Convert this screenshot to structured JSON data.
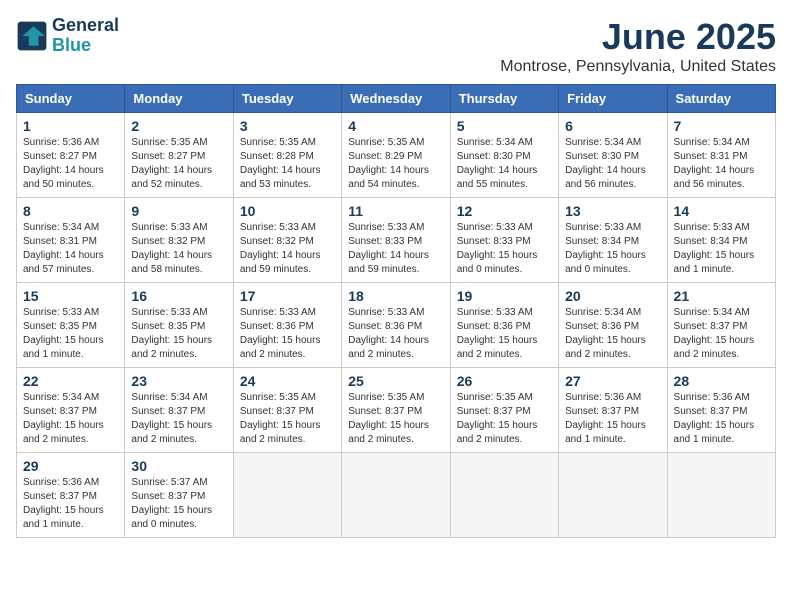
{
  "header": {
    "logo_line1": "General",
    "logo_line2": "Blue",
    "title": "June 2025",
    "subtitle": "Montrose, Pennsylvania, United States"
  },
  "weekdays": [
    "Sunday",
    "Monday",
    "Tuesday",
    "Wednesday",
    "Thursday",
    "Friday",
    "Saturday"
  ],
  "weeks": [
    [
      {
        "day": "1",
        "info": "Sunrise: 5:36 AM\nSunset: 8:27 PM\nDaylight: 14 hours\nand 50 minutes."
      },
      {
        "day": "2",
        "info": "Sunrise: 5:35 AM\nSunset: 8:27 PM\nDaylight: 14 hours\nand 52 minutes."
      },
      {
        "day": "3",
        "info": "Sunrise: 5:35 AM\nSunset: 8:28 PM\nDaylight: 14 hours\nand 53 minutes."
      },
      {
        "day": "4",
        "info": "Sunrise: 5:35 AM\nSunset: 8:29 PM\nDaylight: 14 hours\nand 54 minutes."
      },
      {
        "day": "5",
        "info": "Sunrise: 5:34 AM\nSunset: 8:30 PM\nDaylight: 14 hours\nand 55 minutes."
      },
      {
        "day": "6",
        "info": "Sunrise: 5:34 AM\nSunset: 8:30 PM\nDaylight: 14 hours\nand 56 minutes."
      },
      {
        "day": "7",
        "info": "Sunrise: 5:34 AM\nSunset: 8:31 PM\nDaylight: 14 hours\nand 56 minutes."
      }
    ],
    [
      {
        "day": "8",
        "info": "Sunrise: 5:34 AM\nSunset: 8:31 PM\nDaylight: 14 hours\nand 57 minutes."
      },
      {
        "day": "9",
        "info": "Sunrise: 5:33 AM\nSunset: 8:32 PM\nDaylight: 14 hours\nand 58 minutes."
      },
      {
        "day": "10",
        "info": "Sunrise: 5:33 AM\nSunset: 8:32 PM\nDaylight: 14 hours\nand 59 minutes."
      },
      {
        "day": "11",
        "info": "Sunrise: 5:33 AM\nSunset: 8:33 PM\nDaylight: 14 hours\nand 59 minutes."
      },
      {
        "day": "12",
        "info": "Sunrise: 5:33 AM\nSunset: 8:33 PM\nDaylight: 15 hours\nand 0 minutes."
      },
      {
        "day": "13",
        "info": "Sunrise: 5:33 AM\nSunset: 8:34 PM\nDaylight: 15 hours\nand 0 minutes."
      },
      {
        "day": "14",
        "info": "Sunrise: 5:33 AM\nSunset: 8:34 PM\nDaylight: 15 hours\nand 1 minute."
      }
    ],
    [
      {
        "day": "15",
        "info": "Sunrise: 5:33 AM\nSunset: 8:35 PM\nDaylight: 15 hours\nand 1 minute."
      },
      {
        "day": "16",
        "info": "Sunrise: 5:33 AM\nSunset: 8:35 PM\nDaylight: 15 hours\nand 2 minutes."
      },
      {
        "day": "17",
        "info": "Sunrise: 5:33 AM\nSunset: 8:36 PM\nDaylight: 15 hours\nand 2 minutes."
      },
      {
        "day": "18",
        "info": "Sunrise: 5:33 AM\nSunset: 8:36 PM\nDaylight: 14 hours\nand 2 minutes."
      },
      {
        "day": "19",
        "info": "Sunrise: 5:33 AM\nSunset: 8:36 PM\nDaylight: 15 hours\nand 2 minutes."
      },
      {
        "day": "20",
        "info": "Sunrise: 5:34 AM\nSunset: 8:36 PM\nDaylight: 15 hours\nand 2 minutes."
      },
      {
        "day": "21",
        "info": "Sunrise: 5:34 AM\nSunset: 8:37 PM\nDaylight: 15 hours\nand 2 minutes."
      }
    ],
    [
      {
        "day": "22",
        "info": "Sunrise: 5:34 AM\nSunset: 8:37 PM\nDaylight: 15 hours\nand 2 minutes."
      },
      {
        "day": "23",
        "info": "Sunrise: 5:34 AM\nSunset: 8:37 PM\nDaylight: 15 hours\nand 2 minutes."
      },
      {
        "day": "24",
        "info": "Sunrise: 5:35 AM\nSunset: 8:37 PM\nDaylight: 15 hours\nand 2 minutes."
      },
      {
        "day": "25",
        "info": "Sunrise: 5:35 AM\nSunset: 8:37 PM\nDaylight: 15 hours\nand 2 minutes."
      },
      {
        "day": "26",
        "info": "Sunrise: 5:35 AM\nSunset: 8:37 PM\nDaylight: 15 hours\nand 2 minutes."
      },
      {
        "day": "27",
        "info": "Sunrise: 5:36 AM\nSunset: 8:37 PM\nDaylight: 15 hours\nand 1 minute."
      },
      {
        "day": "28",
        "info": "Sunrise: 5:36 AM\nSunset: 8:37 PM\nDaylight: 15 hours\nand 1 minute."
      }
    ],
    [
      {
        "day": "29",
        "info": "Sunrise: 5:36 AM\nSunset: 8:37 PM\nDaylight: 15 hours\nand 1 minute."
      },
      {
        "day": "30",
        "info": "Sunrise: 5:37 AM\nSunset: 8:37 PM\nDaylight: 15 hours\nand 0 minutes."
      },
      {
        "day": "",
        "info": ""
      },
      {
        "day": "",
        "info": ""
      },
      {
        "day": "",
        "info": ""
      },
      {
        "day": "",
        "info": ""
      },
      {
        "day": "",
        "info": ""
      }
    ]
  ]
}
